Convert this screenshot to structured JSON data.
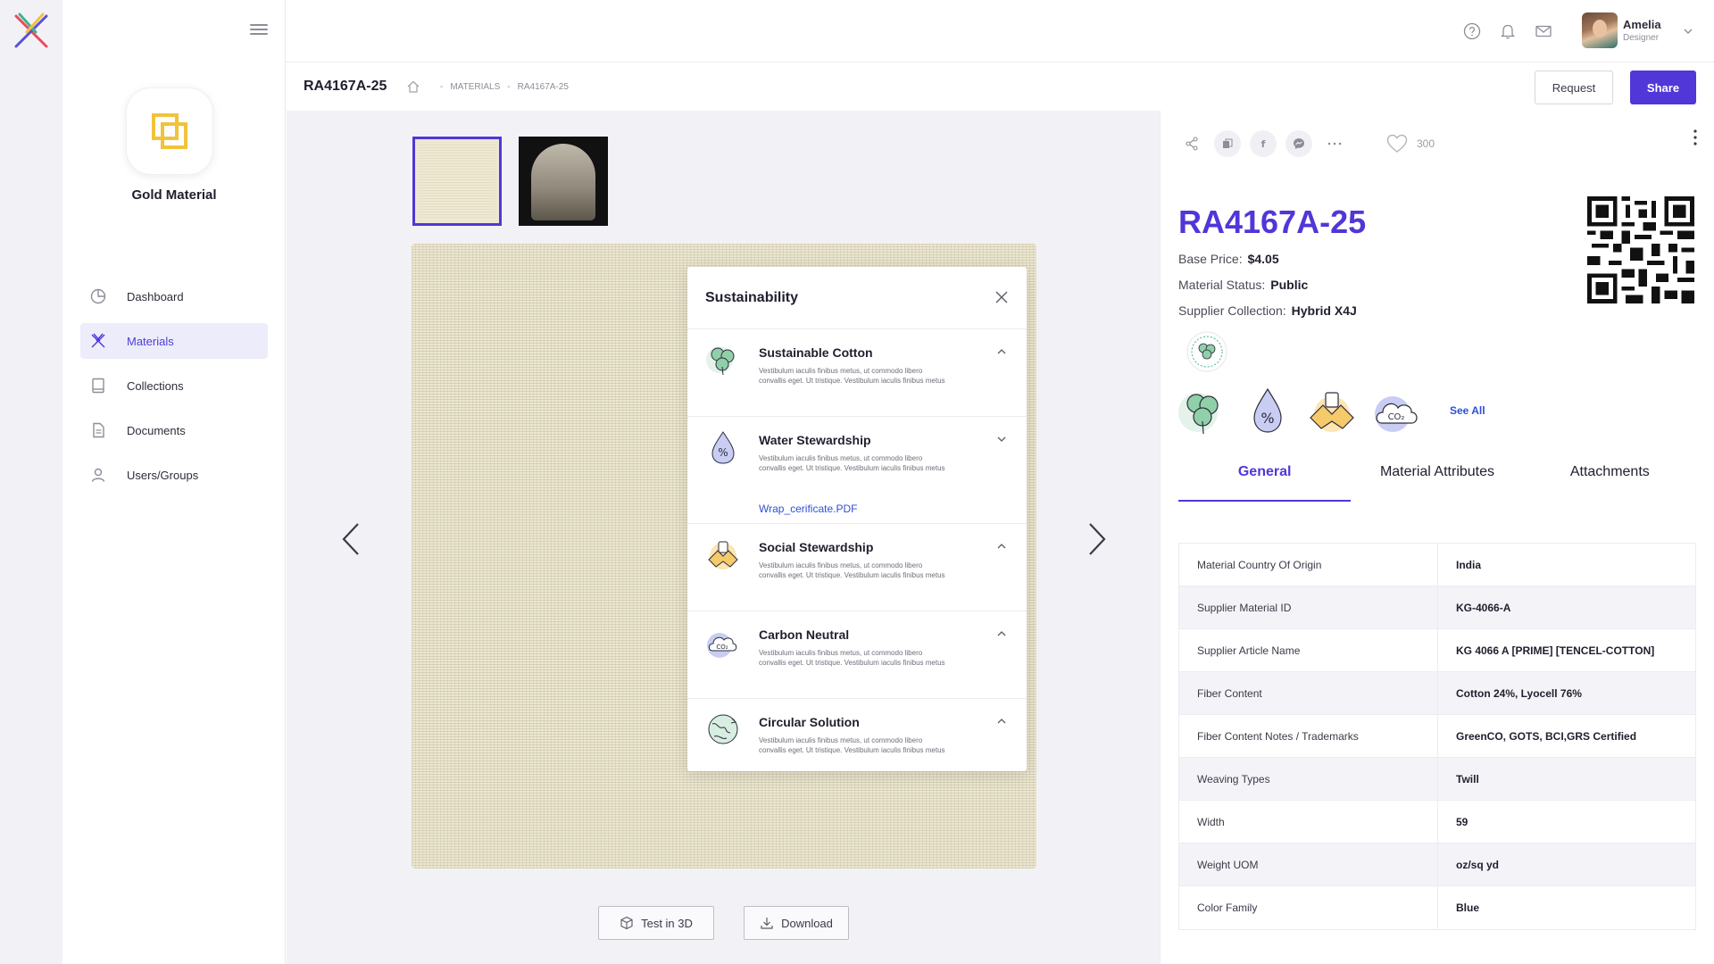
{
  "brand": {
    "name": "Gold Material",
    "accent": "#5136d8",
    "logo_color": "#f2c23a"
  },
  "nav": {
    "items": [
      {
        "label": "Dashboard",
        "icon": "pie-chart-icon"
      },
      {
        "label": "Materials",
        "icon": "materials-icon",
        "active": true
      },
      {
        "label": "Collections",
        "icon": "book-icon"
      },
      {
        "label": "Documents",
        "icon": "document-icon"
      },
      {
        "label": "Users/Groups",
        "icon": "user-icon"
      }
    ]
  },
  "user": {
    "name": "Amelia",
    "role": "Designer"
  },
  "header": {
    "title": "RA4167A-25",
    "breadcrumb": [
      "MATERIALS",
      "RA4167A-25"
    ],
    "request_label": "Request",
    "share_label": "Share"
  },
  "viewer": {
    "test3d_label": "Test in 3D",
    "download_label": "Download"
  },
  "sustainability": {
    "title": "Sustainability",
    "items": [
      {
        "name": "Sustainable Cotton",
        "desc": "Vestibulum iaculis finibus metus, ut commodo libero convallis eget. Ut tristique. Vestibulum iaculis finibus metus",
        "icon": "cotton-icon",
        "expanded": true
      },
      {
        "name": "Water Stewardship",
        "desc": "Vestibulum iaculis finibus metus, ut commodo libero convallis eget. Ut tristique. Vestibulum iaculis finibus metus",
        "link": "Wrap_cerificate.PDF",
        "icon": "water-drop-icon",
        "expanded": false
      },
      {
        "name": "Social Stewardship",
        "desc": "Vestibulum iaculis finibus metus, ut commodo libero convallis eget. Ut tristique. Vestibulum iaculis finibus metus",
        "icon": "hands-icon",
        "expanded": true
      },
      {
        "name": "Carbon Neutral",
        "desc": "Vestibulum iaculis finibus metus, ut commodo libero convallis eget. Ut tristique. Vestibulum iaculis finibus metus",
        "icon": "co2-cloud-icon",
        "expanded": true
      },
      {
        "name": "Circular Solution",
        "desc": "Vestibulum iaculis finibus metus, ut commodo libero convallis eget. Ut tristique. Vestibulum iaculis finibus metus",
        "icon": "globe-icon",
        "expanded": true
      }
    ]
  },
  "detail": {
    "likes": "300",
    "material_id": "RA4167A-25",
    "base_price_label": "Base Price:",
    "base_price": "$4.05",
    "status_label": "Material Status:",
    "status": "Public",
    "supplier_label": "Supplier Collection:",
    "supplier": "Hybrid X4J",
    "see_all": "See All",
    "tabs": [
      "General",
      "Material Attributes",
      "Attachments"
    ],
    "attributes": [
      {
        "key": "Material Country Of Origin",
        "value": "India"
      },
      {
        "key": "Supplier Material ID",
        "value": "KG-4066-A"
      },
      {
        "key": "Supplier Article Name",
        "value": "KG 4066 A [PRIME] [TENCEL-COTTON]"
      },
      {
        "key": "Fiber Content",
        "value": "Cotton 24%, Lyocell 76%"
      },
      {
        "key": "Fiber Content Notes / Trademarks",
        "value": "GreenCO, GOTS, BCI,GRS Certified"
      },
      {
        "key": "Weaving Types",
        "value": "Twill"
      },
      {
        "key": "Width",
        "value": "59"
      },
      {
        "key": "Weight UOM",
        "value": "oz/sq yd"
      },
      {
        "key": "Color Family",
        "value": "Blue"
      }
    ]
  }
}
